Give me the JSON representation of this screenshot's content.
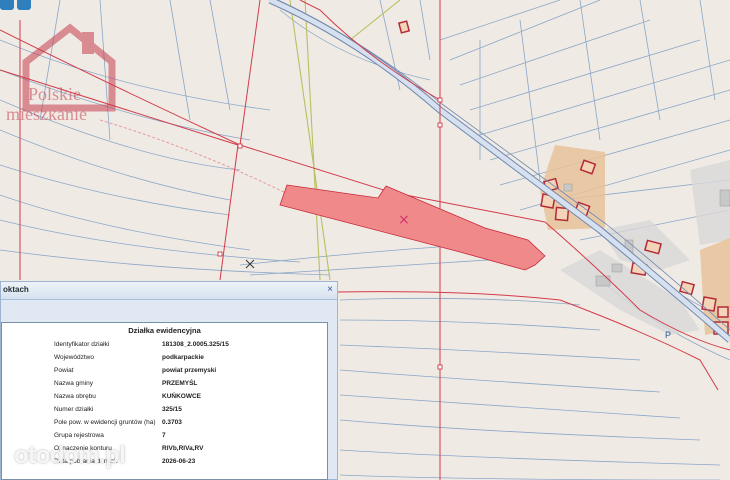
{
  "popup": {
    "header_title": "oktach",
    "close_label": "×",
    "section_title": "Działka ewidencyjna",
    "rows": [
      {
        "label": "Identyfikator działki",
        "value": "181308_2.0005.325/15"
      },
      {
        "label": "Województwo",
        "value": "podkarpackie"
      },
      {
        "label": "Powiat",
        "value": "powiat przemyski"
      },
      {
        "label": "Nazwa gminy",
        "value": "PRZEMYŚL"
      },
      {
        "label": "Nazwa obrębu",
        "value": "KUŃKOWCE"
      },
      {
        "label": "Numer działki",
        "value": "325/15"
      },
      {
        "label": "Pole pow. w ewidencji gruntów (ha)",
        "value": "0.3703"
      },
      {
        "label": "Grupa rejestrowa",
        "value": "7"
      },
      {
        "label": "Oznaczenie konturu",
        "value": "RIVb,RIVa,RV"
      },
      {
        "label": "Data pobrania danych",
        "value": "2026-06-23"
      }
    ]
  },
  "map": {
    "parking_label": "P",
    "marker_symbol": "×"
  },
  "watermarks": {
    "top_line1": "Polskie",
    "top_line2": "mieszkanie",
    "bottom": "otodom.pl"
  },
  "colors": {
    "parcel_fill": "#f08a8a",
    "parcel_border": "#c8283a",
    "boundary": "#d23a4a",
    "building_fill": "#e8c29a",
    "popup_bg": "#dfe8f3"
  }
}
